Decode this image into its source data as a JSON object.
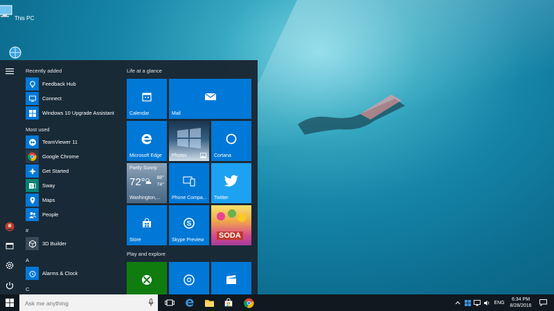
{
  "desktop": {
    "icons": [
      {
        "label": "This PC",
        "icon": "computer-icon"
      },
      {
        "label": "",
        "icon": "network-icon"
      }
    ]
  },
  "start_menu": {
    "recently_added_title": "Recently added",
    "recently_added": [
      {
        "label": "Feedback Hub",
        "icon": "feedback-hub-icon"
      },
      {
        "label": "Connect",
        "icon": "connect-icon"
      },
      {
        "label": "Windows 10 Upgrade Assistant",
        "icon": "upgrade-assistant-icon"
      }
    ],
    "most_used_title": "Most used",
    "most_used": [
      {
        "label": "TeamViewer 11",
        "icon": "teamviewer-icon"
      },
      {
        "label": "Google Chrome",
        "icon": "chrome-icon"
      },
      {
        "label": "Get Started",
        "icon": "get-started-icon"
      },
      {
        "label": "Sway",
        "icon": "sway-icon"
      },
      {
        "label": "Maps",
        "icon": "maps-icon"
      },
      {
        "label": "People",
        "icon": "people-icon"
      }
    ],
    "letter_hash": "#",
    "hash_apps": [
      {
        "label": "3D Builder",
        "icon": "3d-builder-icon"
      }
    ],
    "letter_a": "A",
    "a_apps": [
      {
        "label": "Alarms & Clock",
        "icon": "alarm-clock-icon"
      }
    ],
    "letter_c": "C",
    "group1_title": "Life at a glance",
    "group2_title": "Play and explore",
    "tiles": {
      "calendar": "Calendar",
      "mail": "Mail",
      "edge": "Microsoft Edge",
      "photos": "Photos",
      "cortana": "Cortana",
      "weather_condition": "Partly Sunny",
      "weather_temp": "72°",
      "weather_high": "88°",
      "weather_low": "74°",
      "weather_location": "Washington,...",
      "phone": "Phone Compa...",
      "twitter": "Twitter",
      "store": "Store",
      "skype": "Skype Preview",
      "candy_text": "SODA"
    }
  },
  "taskbar": {
    "search_placeholder": "Ask me anything",
    "language": "ENG",
    "time": "6:34 PM",
    "date": "8/28/2016"
  },
  "colors": {
    "accent": "#0078d7",
    "xbox": "#107c10",
    "start_bg": "#1a2734",
    "taskbar_bg": "#101820"
  }
}
